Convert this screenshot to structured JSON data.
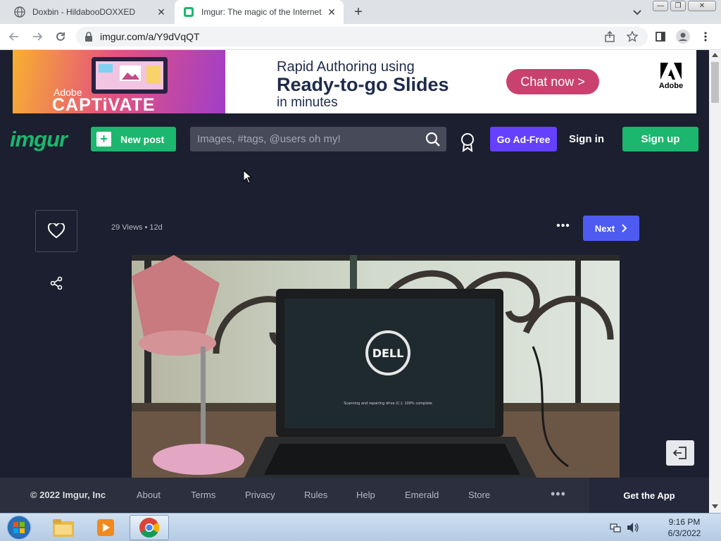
{
  "browser": {
    "tabs": [
      {
        "title": "Doxbin - HildabooDOXXED",
        "active": false
      },
      {
        "title": "Imgur: The magic of the Internet",
        "active": true
      }
    ],
    "new_tab_label": "+",
    "url": "imgur.com/a/Y9dVqQT"
  },
  "ad": {
    "brand": "Adobe",
    "product": "CAPTiVATE",
    "line1": "Rapid Authoring using",
    "line2": "Ready-to-go Slides",
    "line3": "in minutes",
    "cta": "Chat now >",
    "advertiser": "Adobe"
  },
  "header": {
    "logo": "imgur",
    "new_post_label": "New post",
    "search_placeholder": "Images, #tags, @users oh my!",
    "ad_free_label": "Go Ad-Free",
    "sign_in_label": "Sign in",
    "sign_up_label": "Sign up"
  },
  "post": {
    "views": "29 Views",
    "age": "12d",
    "next_label": "Next",
    "screen_text": "Scanning and repairing drive (C:): 100% complete",
    "laptop_brand": "DELL"
  },
  "footer": {
    "copyright": "© 2022 Imgur, Inc",
    "links": [
      "About",
      "Terms",
      "Privacy",
      "Rules",
      "Help",
      "Emerald",
      "Store"
    ],
    "more": "•••",
    "get_app": "Get the App"
  },
  "taskbar": {
    "time": "9:16 PM",
    "date": "6/3/2022"
  },
  "colors": {
    "page_bg": "#1b1f2f",
    "imgur_green": "#1bb76e",
    "ad_free_purple": "#6540ff",
    "next_blue": "#4e5bf1"
  }
}
